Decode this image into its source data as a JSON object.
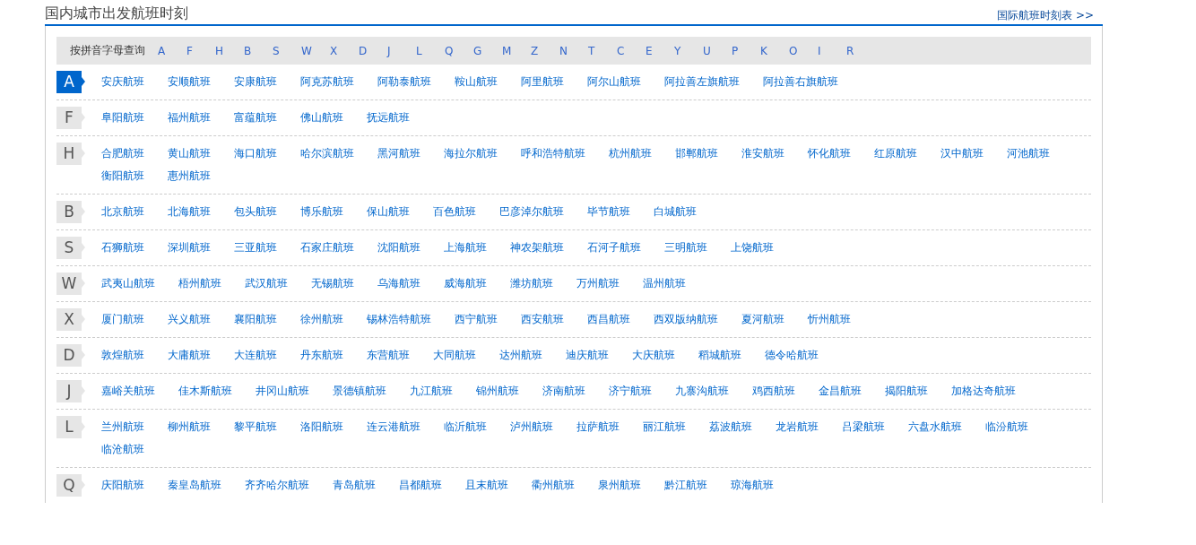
{
  "header": {
    "title": "国内城市出发航班时刻",
    "link": "国际航班时刻表 >>"
  },
  "filter": {
    "label": "按拼音字母查询",
    "letters": [
      "A",
      "F",
      "H",
      "B",
      "S",
      "W",
      "X",
      "D",
      "J",
      "L",
      "Q",
      "G",
      "M",
      "Z",
      "N",
      "T",
      "C",
      "E",
      "Y",
      "U",
      "P",
      "K",
      "O",
      "I",
      "R"
    ]
  },
  "groups": [
    {
      "letter": "A",
      "selected": true,
      "cities": [
        "安庆航班",
        "安顺航班",
        "安康航班",
        "阿克苏航班",
        "阿勒泰航班",
        "鞍山航班",
        "阿里航班",
        "阿尔山航班",
        "阿拉善左旗航班",
        "阿拉善右旗航班"
      ]
    },
    {
      "letter": "F",
      "selected": false,
      "cities": [
        "阜阳航班",
        "福州航班",
        "富蕴航班",
        "佛山航班",
        "抚远航班"
      ]
    },
    {
      "letter": "H",
      "selected": false,
      "cities": [
        "合肥航班",
        "黄山航班",
        "海口航班",
        "哈尔滨航班",
        "黑河航班",
        "海拉尔航班",
        "呼和浩特航班",
        "杭州航班",
        "邯郸航班",
        "淮安航班",
        "怀化航班",
        "红原航班",
        "汉中航班",
        "河池航班",
        "衡阳航班",
        "惠州航班"
      ]
    },
    {
      "letter": "B",
      "selected": false,
      "cities": [
        "北京航班",
        "北海航班",
        "包头航班",
        "博乐航班",
        "保山航班",
        "百色航班",
        "巴彦淖尔航班",
        "毕节航班",
        "白城航班"
      ]
    },
    {
      "letter": "S",
      "selected": false,
      "cities": [
        "石狮航班",
        "深圳航班",
        "三亚航班",
        "石家庄航班",
        "沈阳航班",
        "上海航班",
        "神农架航班",
        "石河子航班",
        "三明航班",
        "上饶航班"
      ]
    },
    {
      "letter": "W",
      "selected": false,
      "cities": [
        "武夷山航班",
        "梧州航班",
        "武汉航班",
        "无锡航班",
        "乌海航班",
        "威海航班",
        "潍坊航班",
        "万州航班",
        "温州航班"
      ]
    },
    {
      "letter": "X",
      "selected": false,
      "cities": [
        "厦门航班",
        "兴义航班",
        "襄阳航班",
        "徐州航班",
        "锡林浩特航班",
        "西宁航班",
        "西安航班",
        "西昌航班",
        "西双版纳航班",
        "夏河航班",
        "忻州航班"
      ]
    },
    {
      "letter": "D",
      "selected": false,
      "cities": [
        "敦煌航班",
        "大庸航班",
        "大连航班",
        "丹东航班",
        "东营航班",
        "大同航班",
        "达州航班",
        "迪庆航班",
        "大庆航班",
        "稻城航班",
        "德令哈航班"
      ]
    },
    {
      "letter": "J",
      "selected": false,
      "cities": [
        "嘉峪关航班",
        "佳木斯航班",
        "井冈山航班",
        "景德镇航班",
        "九江航班",
        "锦州航班",
        "济南航班",
        "济宁航班",
        "九寨沟航班",
        "鸡西航班",
        "金昌航班",
        "揭阳航班",
        "加格达奇航班"
      ]
    },
    {
      "letter": "L",
      "selected": false,
      "cities": [
        "兰州航班",
        "柳州航班",
        "黎平航班",
        "洛阳航班",
        "连云港航班",
        "临沂航班",
        "泸州航班",
        "拉萨航班",
        "丽江航班",
        "荔波航班",
        "龙岩航班",
        "吕梁航班",
        "六盘水航班",
        "临汾航班",
        "临沧航班"
      ]
    },
    {
      "letter": "Q",
      "selected": false,
      "cities": [
        "庆阳航班",
        "秦皇岛航班",
        "齐齐哈尔航班",
        "青岛航班",
        "昌都航班",
        "且末航班",
        "衢州航班",
        "泉州航班",
        "黔江航班",
        "琼海航班"
      ]
    }
  ]
}
